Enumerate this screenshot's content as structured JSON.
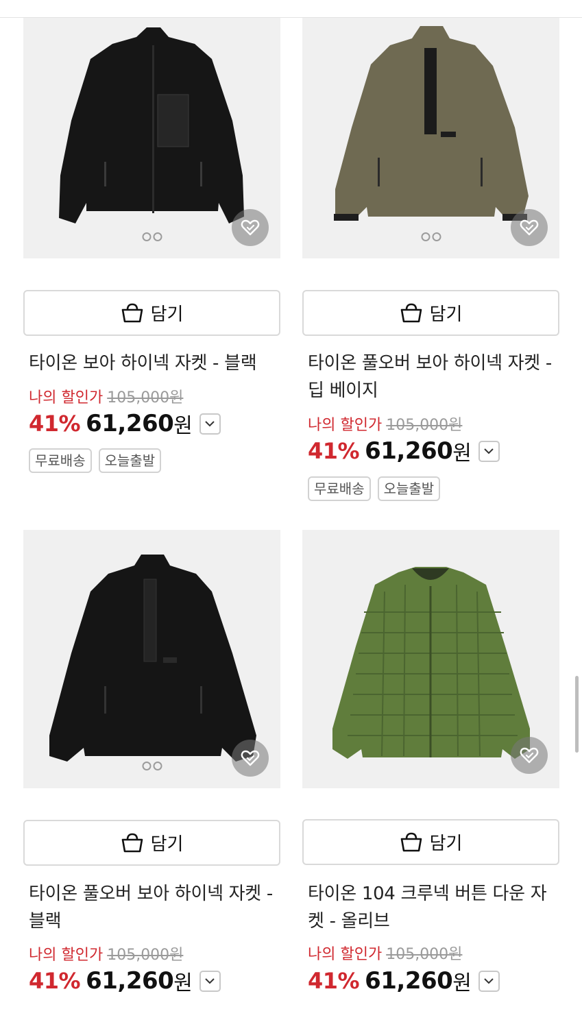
{
  "products": [
    {
      "name": "타이온 보아 하이넥 자켓 - 블랙",
      "cart_label": "담기",
      "my_price_label": "나의 할인가",
      "original_price": "105,000원",
      "discount_pct": "41%",
      "price": "61,260",
      "currency": "원",
      "tags": [
        "무료배송",
        "오늘출발"
      ],
      "image_icon": "black-fleece-zip-jacket",
      "garment_color": "#161616",
      "has_dots": true
    },
    {
      "name": "타이온 풀오버 보아 하이넥 자켓 - 딥 베이지",
      "cart_label": "담기",
      "my_price_label": "나의 할인가",
      "original_price": "105,000원",
      "discount_pct": "41%",
      "price": "61,260",
      "currency": "원",
      "tags": [
        "무료배송",
        "오늘출발"
      ],
      "image_icon": "olive-fleece-pullover",
      "garment_color": "#6f6a52",
      "has_dots": true
    },
    {
      "name": "타이온 풀오버 보아 하이넥 자켓 - 블랙",
      "cart_label": "담기",
      "my_price_label": "나의 할인가",
      "original_price": "105,000원",
      "discount_pct": "41%",
      "price": "61,260",
      "currency": "원",
      "tags": [],
      "image_icon": "black-fleece-pullover",
      "garment_color": "#151515",
      "has_dots": true
    },
    {
      "name": "타이온 104 크루넥 버튼 다운 자켓 - 올리브",
      "cart_label": "담기",
      "my_price_label": "나의 할인가",
      "original_price": "105,000원",
      "discount_pct": "41%",
      "price": "61,260",
      "currency": "원",
      "tags": [],
      "image_icon": "olive-quilted-down-jacket",
      "garment_color": "#607d3c",
      "has_dots": false
    }
  ],
  "colors": {
    "accent_red": "#d0282f",
    "heart_button_bg": "#8a8a8a"
  },
  "icons": {
    "cart": "shopping-basket-icon",
    "wish": "heart-icon",
    "chevron": "chevron-down-icon"
  }
}
